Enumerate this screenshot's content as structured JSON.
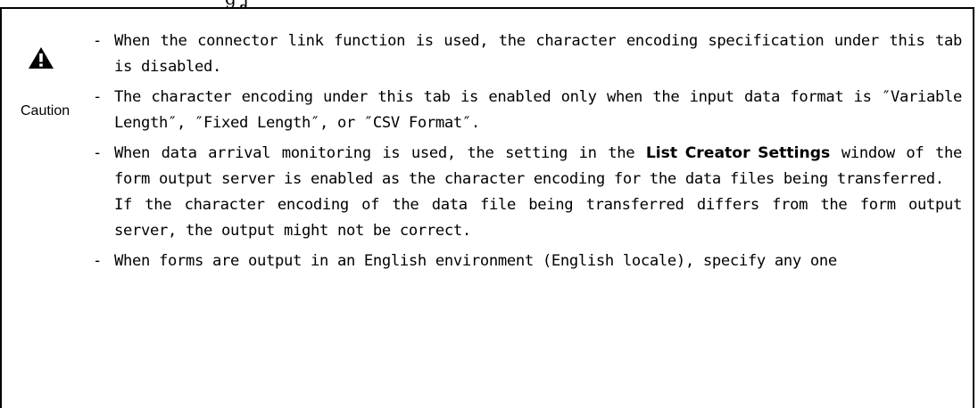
{
  "notice": {
    "label": "Caution",
    "icon": "warning-triangle-icon",
    "items": [
      {
        "paragraphs": [
          [
            "When the connector link function is used, the character encoding specification under this tab is disabled."
          ]
        ]
      },
      {
        "paragraphs": [
          [
            "The character encoding under this tab is enabled only when the input data format is ″Variable Length″, ″Fixed Length″, or ″CSV Format″."
          ]
        ]
      },
      {
        "paragraphs": [
          [
            "When data arrival monitoring is used, the setting in the ",
            "List Creator Settings",
            " window of the form output server is enabled as the character encoding for the data files being transferred."
          ],
          [
            "If the character encoding of the data file being transferred differs from the form output server, the output might not be correct."
          ]
        ]
      },
      {
        "paragraphs": [
          [
            "When forms are output in an English environment (English locale), specify any one"
          ]
        ]
      }
    ]
  }
}
